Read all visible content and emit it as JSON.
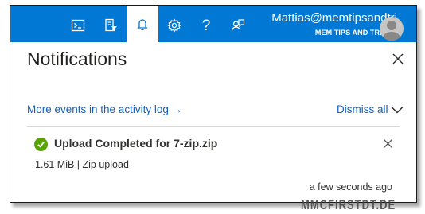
{
  "topbar": {
    "icons": [
      "cloud-shell-icon",
      "directory-filter-icon",
      "notifications-bell-icon",
      "settings-gear-icon",
      "help-icon",
      "feedback-icon"
    ],
    "help_glyph": "?",
    "account": {
      "email": "Mattias@memtipsandtri",
      "tenant": "MEM TIPS AND TRICKS"
    },
    "color": "#0078d4"
  },
  "panel": {
    "title": "Notifications",
    "activity_link": "More events in the activity log",
    "activity_arrow": "→",
    "dismiss_label": "Dismiss all"
  },
  "notification": {
    "status_icon": "success-check-icon",
    "status_color": "#57a300",
    "title": "Upload Completed for 7-zip.zip",
    "detail": "1.61 MiB | Zip upload",
    "time": "a few seconds ago"
  },
  "watermark": "MMCFIRSTDT.DE"
}
